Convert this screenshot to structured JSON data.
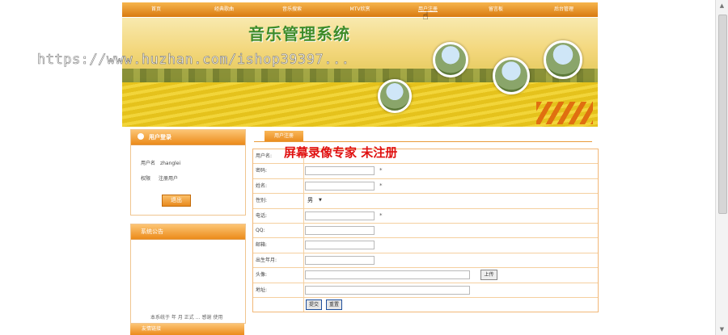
{
  "nav": {
    "items": [
      "首页",
      "经典歌曲",
      "音乐搜索",
      "MTV欣赏",
      "用户注册",
      "留言板",
      "后台管理"
    ],
    "active_index": 4
  },
  "banner": {
    "title": "音乐管理系统"
  },
  "watermark": "https://www.huzhan.com/ishop39397...",
  "login": {
    "header": "用户登录",
    "username_label": "用户名",
    "username_value": "zhanglei",
    "role_label": "权限",
    "role_value": "注册用户",
    "logout_button": "退出"
  },
  "notice": {
    "header": "系统公告",
    "text": "本系统于 年 月 正式 … 感谢 使用"
  },
  "links": {
    "header": "友情链接"
  },
  "register": {
    "tab": "用户注册",
    "rows": {
      "username": "用户名:",
      "password": "密码:",
      "name": "姓名:",
      "gender": "性别:",
      "phone": "电话:",
      "qq": "QQ:",
      "email": "邮箱:",
      "birth": "出生年月:",
      "avatar": "头像:",
      "address": "地址:"
    },
    "required_mark": "*",
    "gender_value": "男",
    "upload_button": "上传",
    "submit_button": "提交",
    "reset_button": "重置"
  },
  "recorder_watermark": "屏幕录像专家 未注册"
}
